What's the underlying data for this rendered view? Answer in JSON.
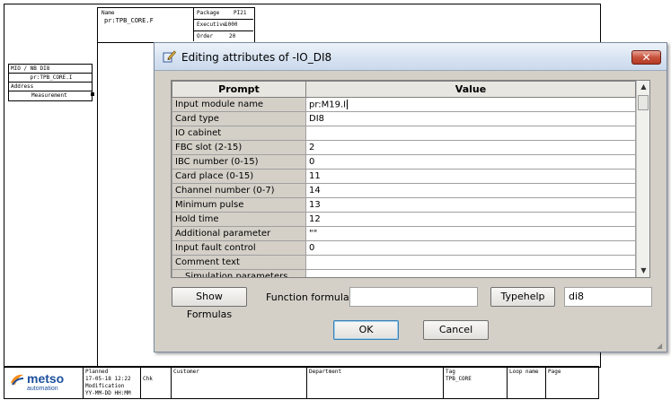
{
  "drawing": {
    "header": {
      "name_label": "Name",
      "name_value": "pr:TPB_CORE.F",
      "package_label": "Package",
      "package_value": "PI21",
      "executive_label": "Executive",
      "executive_value": "1000",
      "order_label": "Order",
      "order_value": "20"
    },
    "symbol": {
      "row1": "MIO  / NB   DI8",
      "row2": "pr:TPB_CORE.I",
      "row3": "Address",
      "row4": "Measurement"
    },
    "titleblock": {
      "logo_text": "metso",
      "logo_sub": "automation",
      "planned_label": "Planned",
      "planned_value": "17-05-18 12:22",
      "modified_label": "Modification",
      "modified_value": "YY-MM-DD HH:MM",
      "chk_label": "Chk",
      "customer_label": "Customer",
      "department_label": "Department",
      "tag_label": "Tag",
      "tag_value": "TPB_CORE",
      "loop_label": "Loop name",
      "page_label": "Page"
    }
  },
  "dialog": {
    "title": "Editing attributes of -IO_DI8",
    "close_label": "✕",
    "columns": {
      "prompt": "Prompt",
      "value": "Value"
    },
    "rows": [
      {
        "prompt": "Input module name",
        "value": "pr:M19.I"
      },
      {
        "prompt": "Card type",
        "value": "DI8"
      },
      {
        "prompt": "IO cabinet",
        "value": ""
      },
      {
        "prompt": "FBC slot (2-15)",
        "value": "2"
      },
      {
        "prompt": "IBC number (0-15)",
        "value": "0"
      },
      {
        "prompt": "Card place (0-15)",
        "value": "11"
      },
      {
        "prompt": "Channel number (0-7)",
        "value": "14"
      },
      {
        "prompt": "Minimum pulse",
        "value": "13"
      },
      {
        "prompt": "Hold time",
        "value": "12"
      },
      {
        "prompt": "Additional parameter",
        "value": "\"\""
      },
      {
        "prompt": "Input fault control",
        "value": "0"
      },
      {
        "prompt": "Comment text",
        "value": ""
      },
      {
        "prompt": "Simulation parameters",
        "value": ""
      }
    ],
    "show_formulas_label": "Show Formulas",
    "function_formula_label": "Function formula:",
    "function_formula_value": "",
    "typehelp_label": "Typehelp",
    "typehelp_value": "di8",
    "ok_label": "OK",
    "cancel_label": "Cancel"
  }
}
